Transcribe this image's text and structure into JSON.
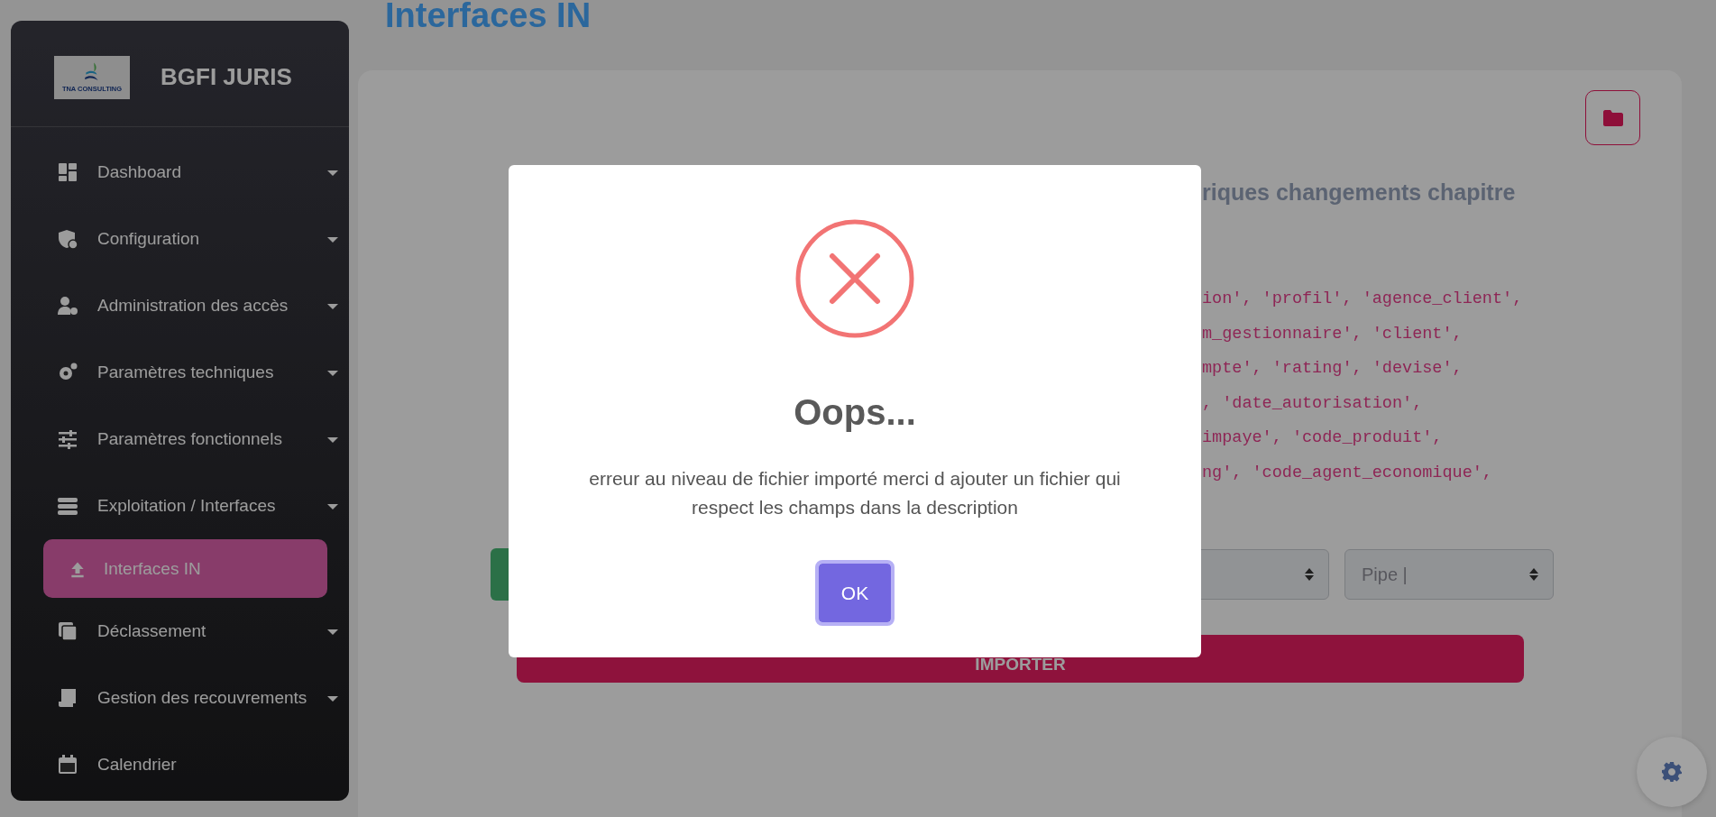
{
  "sidebar": {
    "brand": "BGFI JURIS",
    "logo_text": "TNA CONSULTING",
    "items": [
      {
        "label": "Dashboard",
        "expandable": true,
        "selected": false
      },
      {
        "label": "Configuration",
        "expandable": true,
        "selected": false
      },
      {
        "label": "Administration des accès",
        "expandable": true,
        "selected": false
      },
      {
        "label": "Paramètres techniques",
        "expandable": true,
        "selected": false
      },
      {
        "label": "Paramètres fonctionnels",
        "expandable": true,
        "selected": false
      },
      {
        "label": "Exploitation / Interfaces",
        "expandable": true,
        "selected": false,
        "children": [
          {
            "label": "Interfaces IN",
            "selected": true
          }
        ]
      },
      {
        "label": "Déclassement",
        "expandable": true,
        "selected": false
      },
      {
        "label": "Gestion des recouvrements",
        "expandable": true,
        "selected": false
      },
      {
        "label": "Calendrier",
        "expandable": false,
        "selected": false
      }
    ]
  },
  "page_title": "Interfaces IN",
  "card": {
    "heading": "riques changements chapitre",
    "code_lines": [
      "ion', 'profil', 'agence_client',",
      "m_gestionnaire', 'client',",
      "mpte', 'rating', 'devise',",
      ", 'date_autorisation',",
      "impaye', 'code_produit',",
      "ng', 'code_agent_economique',"
    ],
    "separator_select": "Pipe |",
    "import_button": "IMPORTER"
  },
  "dialog": {
    "title": "Oops...",
    "message": "erreur au niveau de fichier importé merci d ajouter un fichier qui respect les champs dans la description",
    "button": "OK"
  }
}
